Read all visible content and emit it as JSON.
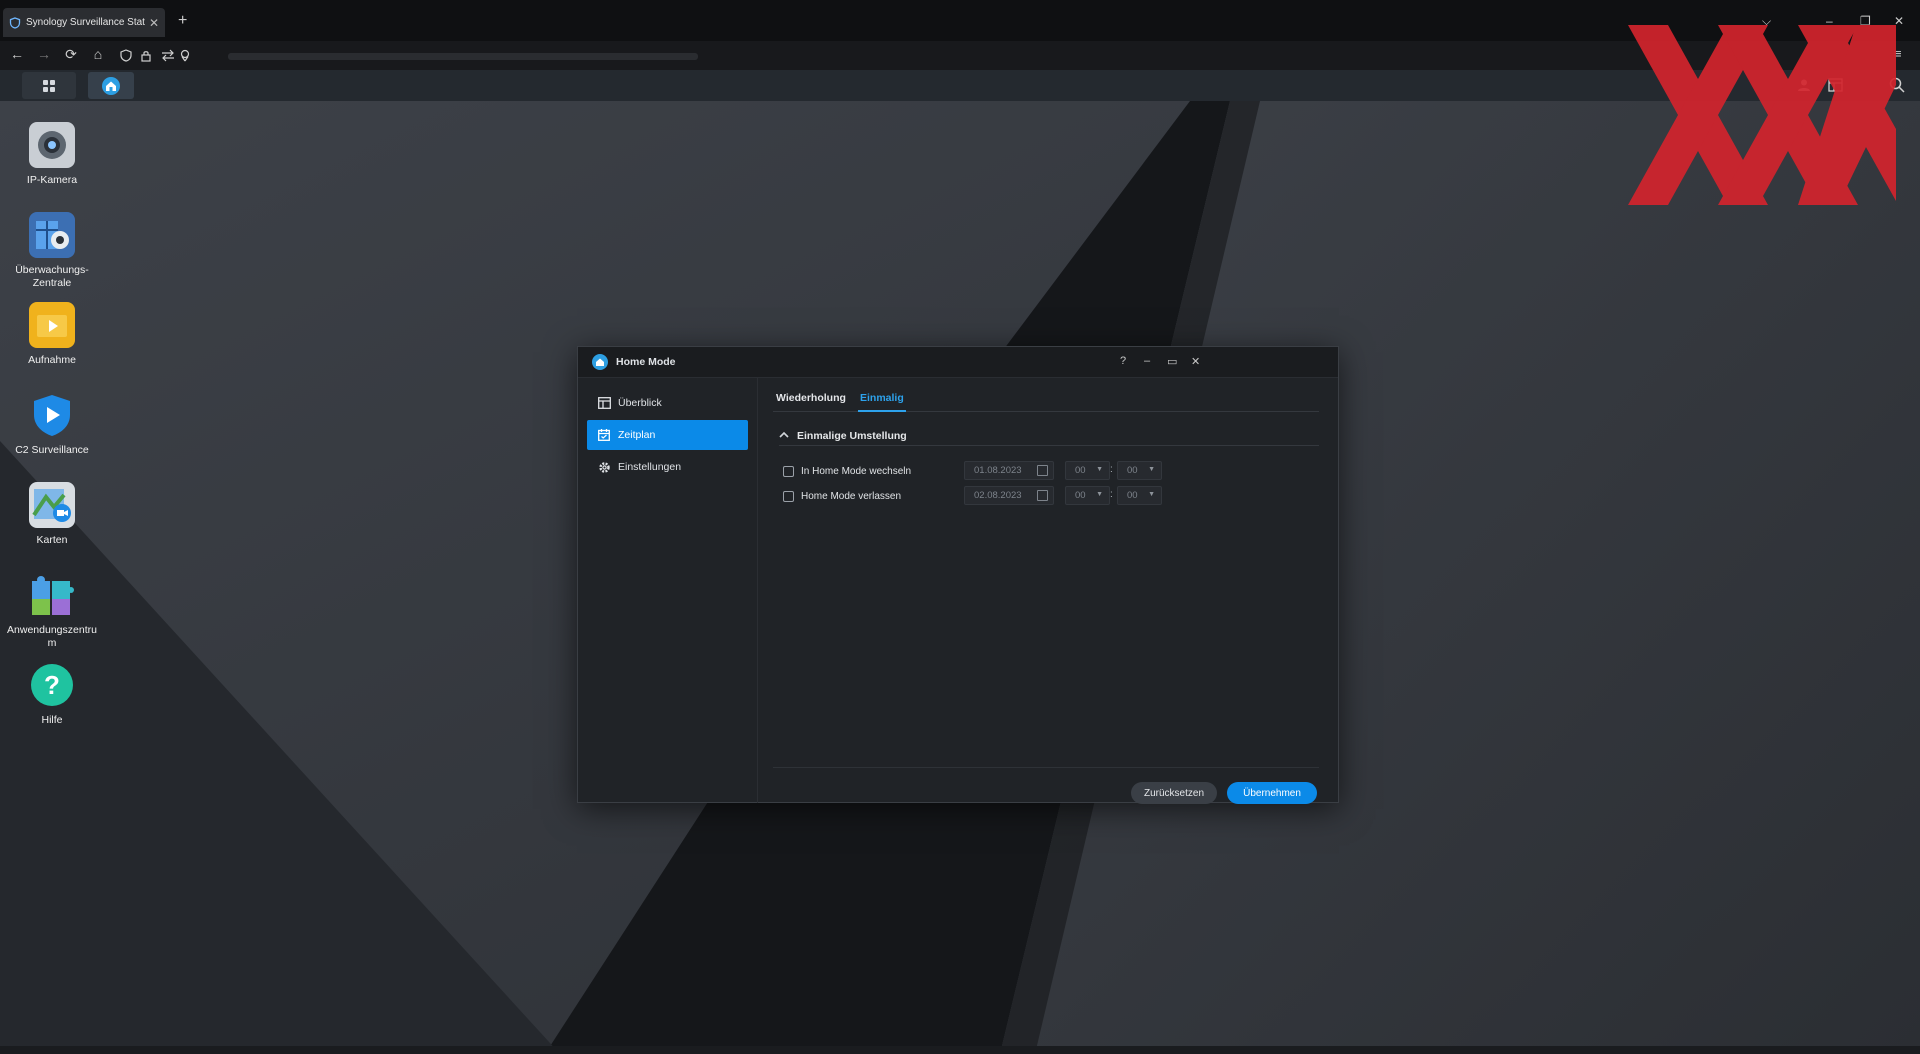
{
  "browser": {
    "tab_title": "Synology Surveillance Station -",
    "tab_close": "✕",
    "new_tab": "+",
    "window_controls": {
      "list": "⌵",
      "minimize": "–",
      "restore": "❐",
      "close": "✕"
    },
    "nav": {
      "back": "←",
      "forward": "→",
      "reload": "⟳",
      "home": "⌂",
      "menu": "≡"
    }
  },
  "desktop": {
    "icons": [
      {
        "label_lines": [
          "IP-Kamera"
        ]
      },
      {
        "label_lines": [
          "Überwachungs-",
          "Zentrale"
        ]
      },
      {
        "label_lines": [
          "Aufnahme"
        ]
      },
      {
        "label_lines": [
          "C2 Surveillance"
        ]
      },
      {
        "label_lines": [
          "Karten"
        ]
      },
      {
        "label_lines": [
          "Anwendungszentru",
          "m"
        ]
      },
      {
        "label_lines": [
          "Hilfe"
        ]
      }
    ]
  },
  "dialog": {
    "title": "Home Mode",
    "controls": {
      "help": "?",
      "minimize": "–",
      "maximize": "▭",
      "close": "✕"
    },
    "sidebar": [
      {
        "label": "Überblick",
        "icon": "overview-icon"
      },
      {
        "label": "Zeitplan",
        "icon": "calendar-icon",
        "active": true
      },
      {
        "label": "Einstellungen",
        "icon": "gear-icon"
      }
    ],
    "tabs": [
      {
        "label": "Wiederholung"
      },
      {
        "label": "Einmalig",
        "active": true
      }
    ],
    "section_title": "Einmalige Umstellung",
    "rows": [
      {
        "label": "In Home Mode wechseln",
        "checked": false,
        "date": "01.08.2023",
        "hour": "00",
        "minute": "00"
      },
      {
        "label": "Home Mode verlassen",
        "checked": false,
        "date": "02.08.2023",
        "hour": "00",
        "minute": "00"
      }
    ],
    "time_separator": ":",
    "buttons": {
      "reset": "Zurücksetzen",
      "apply": "Übernehmen"
    }
  },
  "colors": {
    "accent": "#0b8ae8",
    "tab_active": "#2da2ec",
    "logo_red": "#d3242d"
  }
}
